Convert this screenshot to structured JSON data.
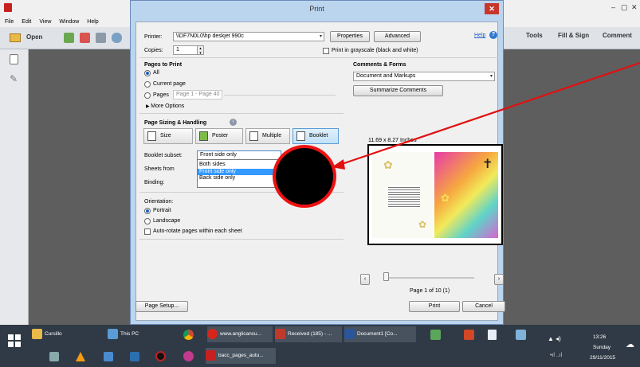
{
  "app": {
    "title": "",
    "menu": [
      "File",
      "Edit",
      "View",
      "Window",
      "Help"
    ],
    "open_label": "Open",
    "right_tabs": [
      "Tools",
      "Fill & Sign",
      "Comment"
    ]
  },
  "dialog": {
    "title": "Print",
    "close": "✕",
    "printer_label": "Printer:",
    "printer_value": "\\\\DF7N0L0\\hp deskjet 990c",
    "properties": "Properties",
    "advanced": "Advanced",
    "help": "Help",
    "copies_label": "Copies:",
    "copies_value": "1",
    "grayscale": "Print in grayscale (black and white)",
    "pages_to_print": "Pages to Print",
    "all": "All",
    "current_page": "Current page",
    "pages": "Pages",
    "pages_value": "Page 1 - Page 40",
    "more_options": "More Options",
    "comments_forms": "Comments & Forms",
    "comments_value": "Document and Markups",
    "summarize": "Summarize Comments",
    "sizing": "Page Sizing & Handling",
    "seg": {
      "size": "Size",
      "poster": "Poster",
      "multiple": "Multiple",
      "booklet": "Booklet"
    },
    "booklet_subset": "Booklet subset:",
    "booklet_subset_value": "Front side only",
    "subset_options": [
      "Both sides",
      "Front side only",
      "Back side only"
    ],
    "sheets_from": "Sheets from",
    "binding": "Binding:",
    "orientation": "Orientation:",
    "portrait": "Portrait",
    "landscape": "Landscape",
    "auto_rotate": "Auto-rotate pages within each sheet",
    "paper_size": "11.69 x 8.27 Inches",
    "page_of": "Page 1 of 10 (1)",
    "page_setup": "Page Setup...",
    "print": "Print",
    "cancel": "Cancel"
  },
  "taskbar": {
    "items_top": [
      "Cursillo",
      "This PC",
      "www.anglicancu...",
      "Received (185) - ...",
      "Document1 [Co..."
    ],
    "items_bottom": [
      "bacc_pages_autu..."
    ],
    "time": "13:26",
    "day": "Sunday",
    "date": "29/11/2015"
  },
  "colors": {
    "annotation": "#e11111",
    "selection": "#3399ff",
    "dialog_frame": "#bcd5ee"
  }
}
